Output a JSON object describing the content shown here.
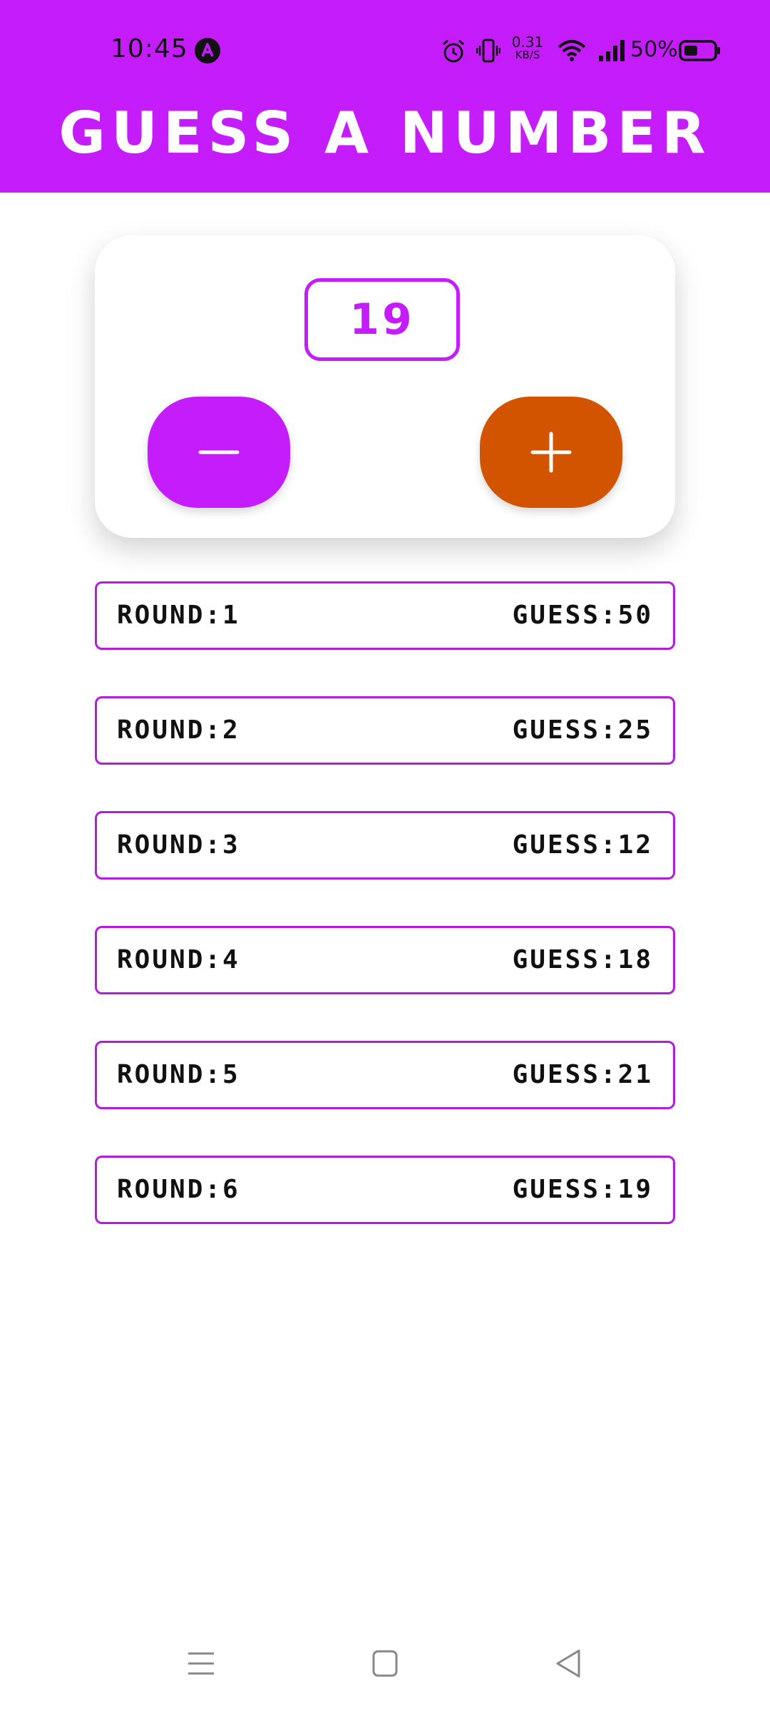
{
  "status_bar": {
    "time": "10:45",
    "net_speed_value": "0.31",
    "net_speed_unit": "KB/S",
    "battery": "50%"
  },
  "header": {
    "title": "GUESS A NUMBER",
    "background_color": "#c51cfb"
  },
  "game": {
    "current_guess": "19",
    "minus_label": "−",
    "plus_label": "+",
    "minus_color": "#c51cfb",
    "plus_color": "#d35400"
  },
  "rounds": [
    {
      "round": "ROUND:1",
      "guess": "GUESS:50"
    },
    {
      "round": "ROUND:2",
      "guess": "GUESS:25"
    },
    {
      "round": "ROUND:3",
      "guess": "GUESS:12"
    },
    {
      "round": "ROUND:4",
      "guess": "GUESS:18"
    },
    {
      "round": "ROUND:5",
      "guess": "GUESS:21"
    },
    {
      "round": "ROUND:6",
      "guess": "GUESS:19"
    }
  ],
  "nav_bar": {
    "icons": [
      "menu-icon",
      "home-icon",
      "back-icon"
    ]
  }
}
